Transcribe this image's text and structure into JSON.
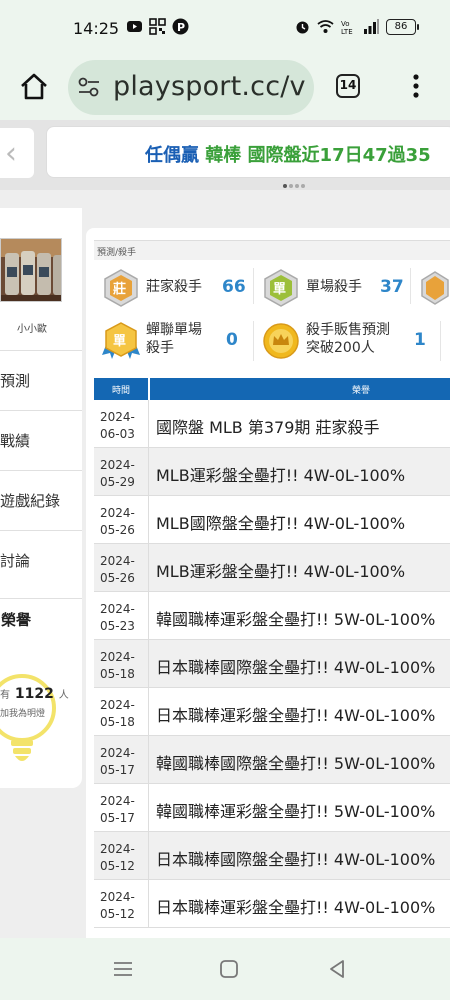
{
  "status": {
    "time": "14:25",
    "battery": "86"
  },
  "browser": {
    "url": "playsport.cc/v",
    "tab_count": "14"
  },
  "banner": {
    "name": "任偶贏",
    "team": "韓棒",
    "record": "國際盤近17日47過35"
  },
  "sidebar": {
    "user_name": "小小歐",
    "items": [
      {
        "label": "預測"
      },
      {
        "label": "戰績"
      },
      {
        "label": "遊戲紀錄"
      },
      {
        "label": "討論"
      }
    ],
    "active_label": "榮譽",
    "fans": {
      "prefix": "有",
      "count": "1122",
      "suffix": "人",
      "note": "加我為明燈"
    }
  },
  "breadcrumb": "預測/殺手",
  "awards": [
    {
      "label": "莊家殺手",
      "count": "66",
      "medal": "莊"
    },
    {
      "label": "單場殺手",
      "count": "37",
      "medal": "單"
    },
    {
      "label": "蟬聯單場\n殺手",
      "count": "0",
      "medal": "單"
    },
    {
      "label": "殺手販售預測\n突破200人",
      "count": "1",
      "medal": "crown"
    }
  ],
  "table": {
    "headers": {
      "time": "時間",
      "honor": "榮譽"
    },
    "rows": [
      {
        "date": "2024-\n06-03",
        "honor": "國際盤 MLB 第379期 莊家殺手"
      },
      {
        "date": "2024-\n05-29",
        "honor": "MLB運彩盤全壘打!! 4W-0L-100%"
      },
      {
        "date": "2024-\n05-26",
        "honor": "MLB國際盤全壘打!! 4W-0L-100%"
      },
      {
        "date": "2024-\n05-26",
        "honor": "MLB運彩盤全壘打!! 4W-0L-100%"
      },
      {
        "date": "2024-\n05-23",
        "honor": "韓國職棒運彩盤全壘打!! 5W-0L-100%"
      },
      {
        "date": "2024-\n05-18",
        "honor": "日本職棒國際盤全壘打!! 4W-0L-100%"
      },
      {
        "date": "2024-\n05-18",
        "honor": "日本職棒運彩盤全壘打!! 4W-0L-100%"
      },
      {
        "date": "2024-\n05-17",
        "honor": "韓國職棒國際盤全壘打!! 5W-0L-100%"
      },
      {
        "date": "2024-\n05-17",
        "honor": "韓國職棒運彩盤全壘打!! 5W-0L-100%"
      },
      {
        "date": "2024-\n05-12",
        "honor": "日本職棒國際盤全壘打!! 4W-0L-100%"
      },
      {
        "date": "2024-\n05-12",
        "honor": "日本職棒運彩盤全壘打!! 4W-0L-100%"
      }
    ]
  },
  "colors": {
    "header_blue": "#1467b3",
    "count_blue": "#2e86c9",
    "banner_green": "#3aa03a",
    "banner_blue": "#1a5fb4"
  }
}
